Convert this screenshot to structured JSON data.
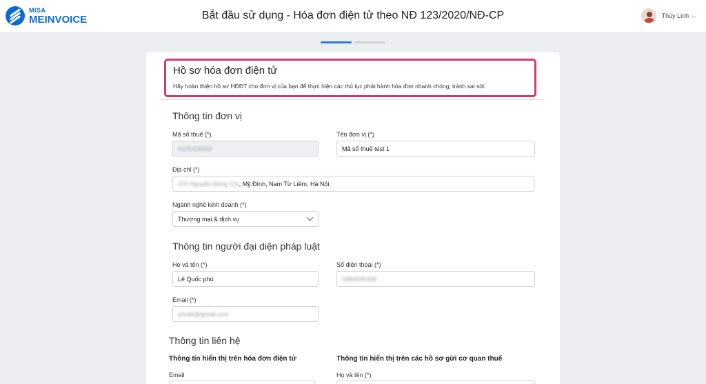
{
  "header": {
    "logo_brand": "MISA",
    "logo_product": "MEINVOICE",
    "title": "Bắt đầu sử dụng - Hóa đơn điện tử theo NĐ 123/2020/NĐ-CP",
    "user_name": "Thùy Linh",
    "user_caret": "⌵"
  },
  "steps": {
    "total": 2,
    "current": 1
  },
  "intro": {
    "title": "Hồ sơ hóa đơn điện tử",
    "description": "Hãy hoàn thiện hồ sơ HĐĐT cho đơn vị của bạn để thực hiện các thủ tục  phát hành hóa đơn nhanh chóng, tránh sai sót."
  },
  "unit_info": {
    "title": "Thông tin đơn vị",
    "tax_code_label": "Mã số thuế (*)",
    "tax_code_value": "0101426950",
    "unit_name_label": "Tên đơn vị (*)",
    "unit_name_value": "Mã số thuế test 1",
    "address_label": "Địa chỉ (*)",
    "address_hidden": "370 Nguyễn Đông Chi",
    "address_value": ", Mỹ Đình, Nam Từ Liêm, Hà Nội",
    "business_label": "Ngành nghề kinh doanh (*)",
    "business_value": "Thương mại & dịch vụ"
  },
  "legal_rep": {
    "title": "Thông tin người đại diện pháp luật",
    "name_label": "Họ và tên (*)",
    "name_value": "Lê Quốc phú",
    "phone_label": "Số điện thoại (*)",
    "phone_value": "0984935458",
    "email_label": "Email (*)",
    "email_value": "phulle@gmail.com"
  },
  "contact": {
    "title": "Thông tin liên hệ",
    "invoice_subtitle": "Thông tin hiển thị trên hóa đơn điện tử",
    "tax_subtitle": "Thông tin hiển thị trên các hồ sơ gửi cơ quan thuế",
    "email_label": "Email",
    "name_label": "Họ và tên (*)"
  },
  "colors": {
    "brand": "#0a6bd6",
    "highlight_border": "#d23b6c",
    "step_active": "#2d7ad6",
    "page_background": "#eceef1"
  }
}
